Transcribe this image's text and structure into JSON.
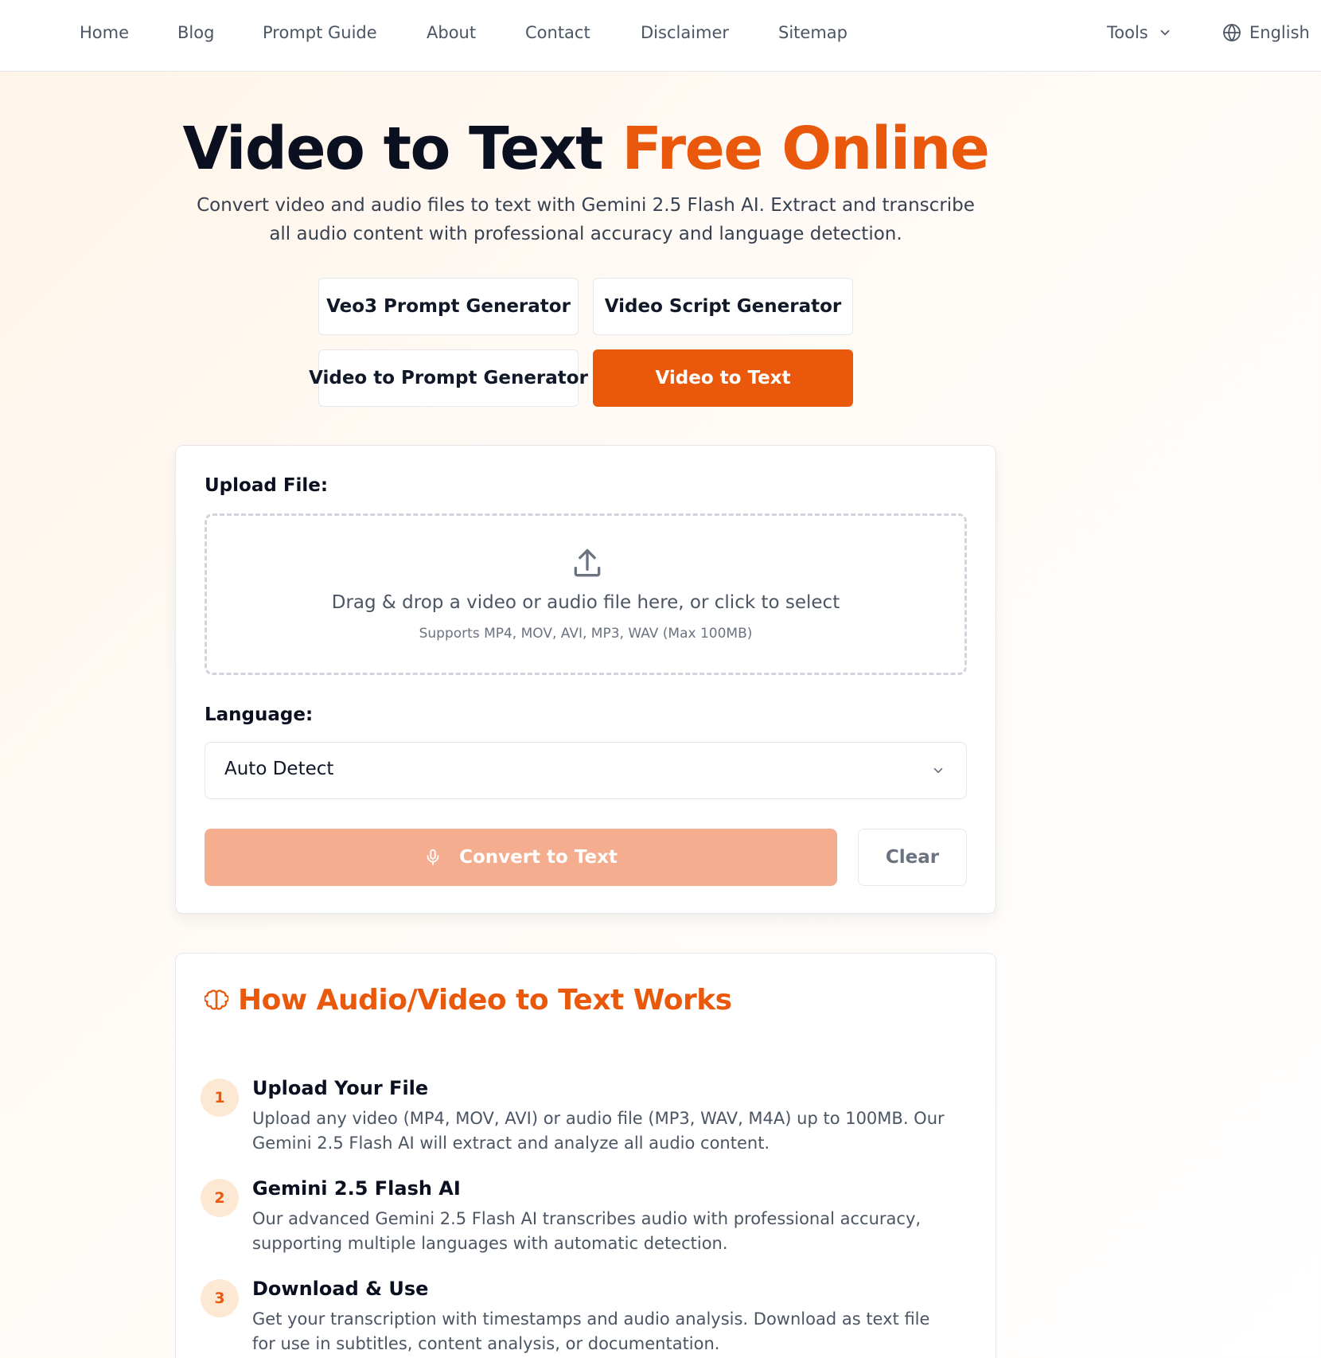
{
  "nav": {
    "links": [
      "Home",
      "Blog",
      "Prompt Guide",
      "About",
      "Contact",
      "Disclaimer",
      "Sitemap"
    ],
    "tools_label": "Tools",
    "language_label": "English"
  },
  "hero": {
    "title_main": "Video to Text",
    "title_accent": "Free Online",
    "subtitle": "Convert video and audio files to text with Gemini 2.5 Flash AI. Extract and transcribe all audio content with professional accuracy and language detection."
  },
  "tool_buttons": [
    "Veo3 Prompt Generator",
    "Video Script Generator",
    "Video to Prompt Generator",
    "Video to Text"
  ],
  "upload": {
    "label": "Upload File:",
    "drop_text": "Drag & drop a video or audio file here, or click to select",
    "supports_text": "Supports MP4, MOV, AVI, MP3, WAV (Max 100MB)"
  },
  "language": {
    "label": "Language:",
    "selected": "Auto Detect"
  },
  "actions": {
    "convert_label": "Convert to Text",
    "clear_label": "Clear"
  },
  "how": {
    "title": "How Audio/Video to Text Works",
    "steps": [
      {
        "num": "1",
        "title": "Upload Your File",
        "desc": "Upload any video (MP4, MOV, AVI) or audio file (MP3, WAV, M4A) up to 100MB. Our Gemini 2.5 Flash AI will extract and analyze all audio content."
      },
      {
        "num": "2",
        "title": "Gemini 2.5 Flash AI",
        "desc": "Our advanced Gemini 2.5 Flash AI transcribes audio with professional accuracy, supporting multiple languages with automatic detection."
      },
      {
        "num": "3",
        "title": "Download & Use",
        "desc": "Get your transcription with timestamps and audio analysis. Download as text file for use in subtitles, content analysis, or documentation."
      }
    ]
  },
  "colors": {
    "accent": "#ea580c",
    "accent_disabled": "#f5ad8f",
    "step_badge_bg": "#fde8d4"
  }
}
